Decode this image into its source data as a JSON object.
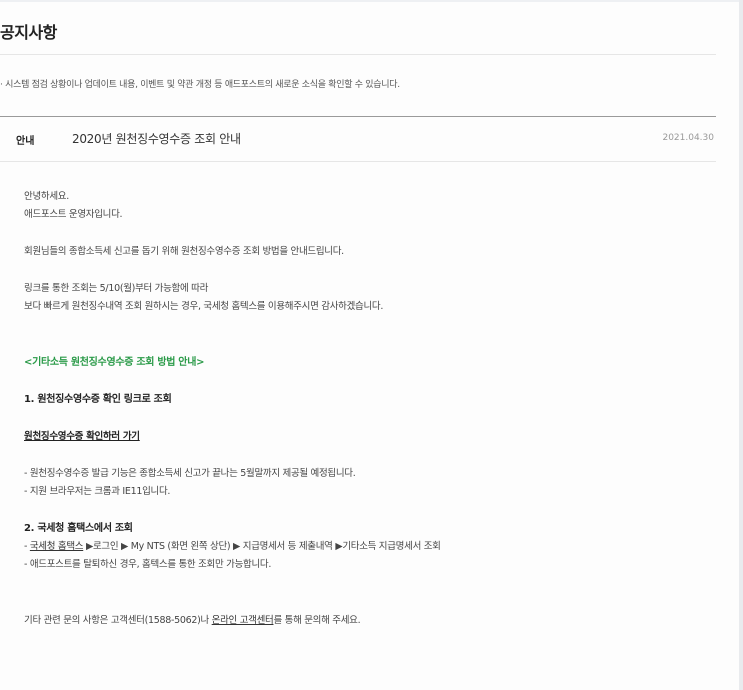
{
  "page": {
    "title": "공지사항",
    "intro": "· 시스템 점검 상황이나 업데이트 내용, 이벤트 및 약관 개정 등 애드포스트의 새로운 소식을 확인할 수 있습니다."
  },
  "notice": {
    "category": "안내",
    "title": "2020년 원천징수영수증 조회 안내",
    "date": "2021.04.30"
  },
  "content": {
    "greeting_1": "안녕하세요.",
    "greeting_2": "애드포스트 운영자입니다.",
    "para_1": "회원님들의 종합소득세 신고를 돕기 위해 원천징수영수증 조회 방법을 안내드립니다.",
    "para_2_line_1": "링크를 통한 조회는 5/10(월)부터 가능함에 따라",
    "para_2_line_2": "보다 빠르게 원천징수내역 조회 원하시는 경우, 국세청 홈텍스를 이용해주시면 감사하겠습니다.",
    "section_heading": "<기타소득 원천징수영수증 조회 방법 안내>",
    "step_1_heading": "1. 원천징수영수증 확인 링크로 조회",
    "step_1_link": "원천징수영수증 확인하러 가기",
    "step_1_note_1": "- 원천징수영수증 발급 기능은 종합소득세 신고가 끝나는 5월말까지 제공될 예정됩니다.",
    "step_1_note_2": "- 지원 브라우저는 크롬과 IE11입니다.",
    "step_2_heading": "2. 국세청 홈택스에서 조회",
    "step_2_prefix": "- ",
    "step_2_link": "국세청 홈택스",
    "step_2_path": " ▶로그인 ▶ My NTS (화면 왼쪽 상단) ▶ 지급명세서 등 제출내역 ▶기타소득 지급명세서 조회",
    "step_2_note": "- 애드포스트를 탈퇴하신 경우, 홈텍스를 통한 조회만 가능합니다.",
    "closing_pre": "기타 관련 문의 사항은 고객센터(1588-5062)나 ",
    "closing_link": "온라인 고객센터",
    "closing_post": "를 통해 문의해 주세요."
  }
}
